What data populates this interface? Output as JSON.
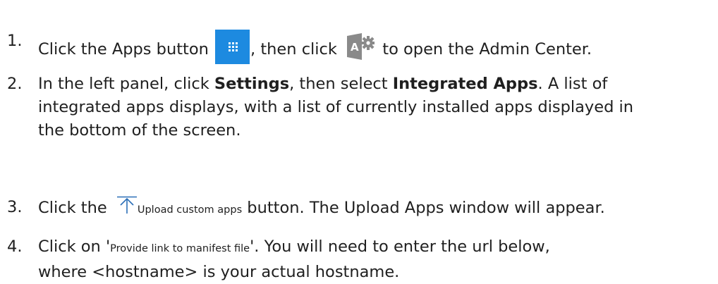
{
  "steps": [
    {
      "number": "1.",
      "text_a": "Click the Apps button",
      "text_b": ", then click",
      "text_c": "to open the Admin Center.",
      "icons": [
        "apps-grid-icon",
        "admin-center-icon"
      ],
      "admin_icon_letter": "A",
      "apps_button_color": "#1d8ae0"
    },
    {
      "number": "2.",
      "line1_a": "In the left panel, click",
      "bold1": "Settings",
      "line1_b": ", then select",
      "bold2": "Integrated Apps",
      "line1_c": ".  A list of",
      "line2": "integrated apps displays, with a list of currently installed apps displayed in",
      "line3": "the bottom of the screen."
    },
    {
      "number": "3.",
      "text_a": "Click the",
      "button_label": "Upload custom apps",
      "icon": "upload-arrow-icon",
      "text_b": "button.  The Upload Apps window will appear."
    },
    {
      "number": "4.",
      "text_a": "Click on '",
      "link_label": "Provide link to manifest file",
      "text_b": "'.  You will need to enter the url below,",
      "line2": "where <hostname> is your actual hostname."
    }
  ]
}
